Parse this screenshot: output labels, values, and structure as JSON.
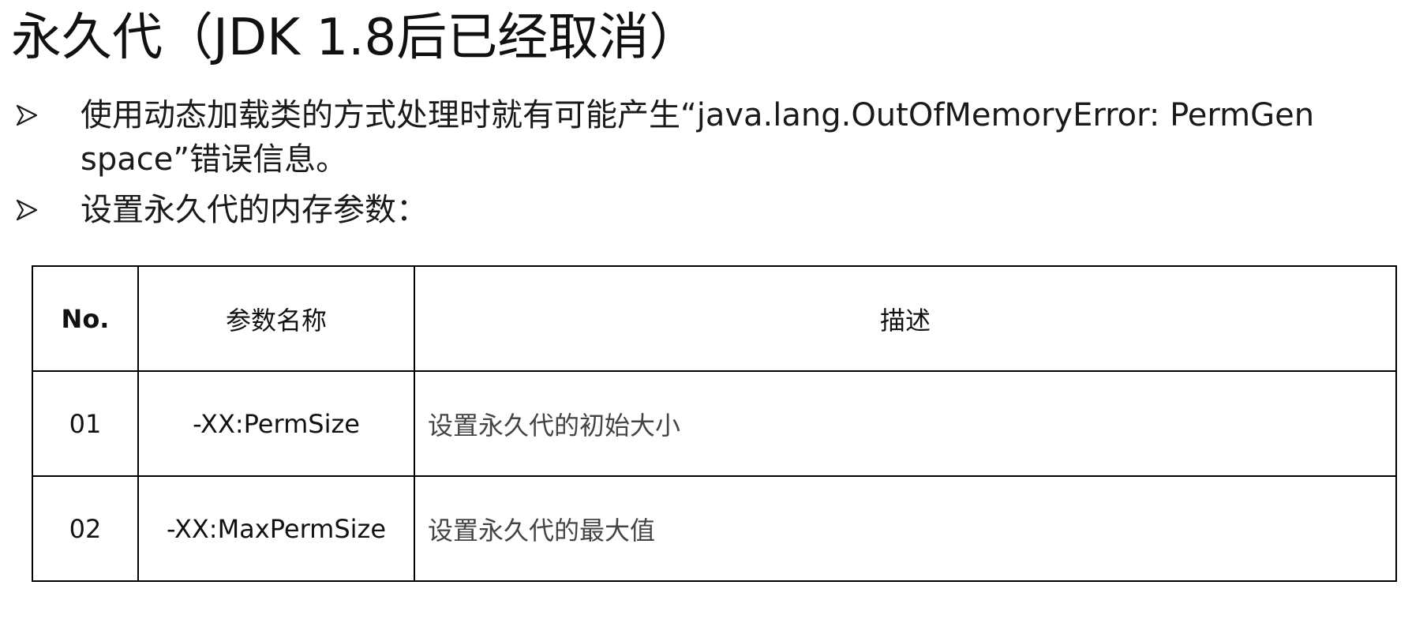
{
  "slide": {
    "title": "永久代（JDK 1.8后已经取消）",
    "bullets": [
      "使用动态加载类的方式处理时就有可能产生“java.lang.OutOfMemoryError: PermGen space”错误信息。",
      "设置永久代的内存参数："
    ],
    "bullet_icon": "arrow-right-icon"
  },
  "table": {
    "headers": [
      "No.",
      "参数名称",
      "描述"
    ],
    "rows": [
      {
        "no": "01",
        "name": "-XX:PermSize",
        "desc": "设置永久代的初始大小"
      },
      {
        "no": "02",
        "name": "-XX:MaxPermSize",
        "desc": "设置永久代的最大值"
      }
    ]
  }
}
